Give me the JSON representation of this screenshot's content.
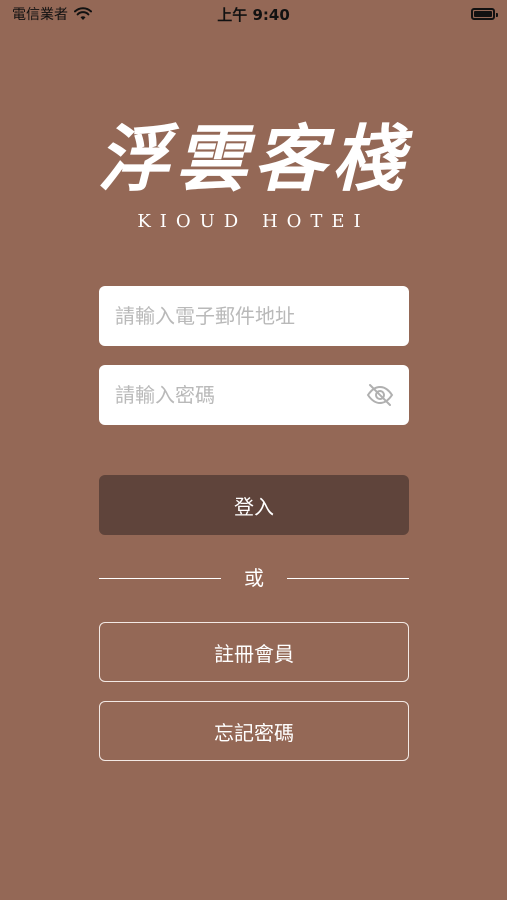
{
  "status_bar": {
    "carrier": "電信業者",
    "time": "上午 9:40"
  },
  "logo": {
    "chinese": "浮雲客棧",
    "english": "KIOUD HOTEI"
  },
  "email": {
    "placeholder": "請輸入電子郵件地址"
  },
  "password": {
    "placeholder": "請輸入密碼",
    "toggle_icon": "eye-slash-icon"
  },
  "login_button": "登入",
  "divider_text": "或",
  "register_button": "註冊會員",
  "forgot_button": "忘記密碼",
  "colors": {
    "background": "#946856",
    "primary_button": "#5f443b"
  }
}
